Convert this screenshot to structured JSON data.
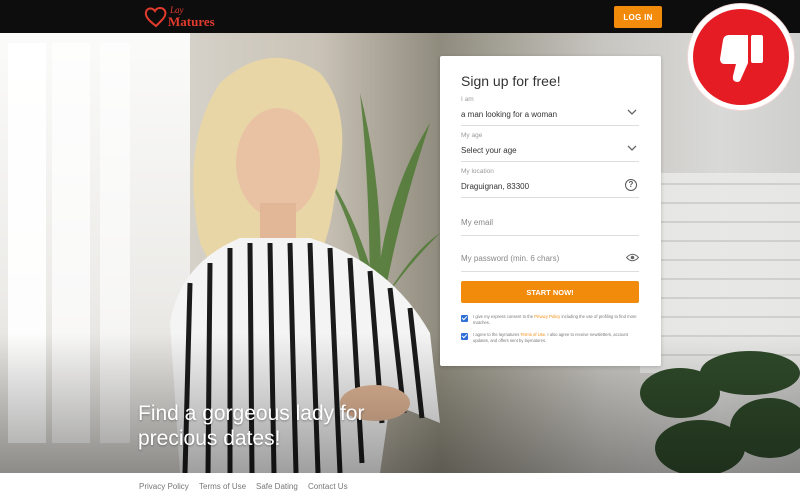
{
  "header": {
    "logo_line1": "Lay",
    "logo_line2": "Matures",
    "login_label": "LOG IN"
  },
  "hero": {
    "tagline": "Find a gorgeous lady for precious dates!"
  },
  "signup": {
    "title": "Sign up for free!",
    "fields": [
      {
        "label": "I am",
        "value": "a man looking for a woman"
      },
      {
        "label": "My age",
        "value": "Select your age"
      },
      {
        "label": "My location",
        "value": "Draguignan, 83300"
      },
      {
        "placeholder": "My email"
      },
      {
        "placeholder": "My password (min. 6 chars)"
      }
    ],
    "submit_label": "START NOW!",
    "consent1": {
      "before": "I give my express consent to the ",
      "link": "Privacy Policy",
      "after": " including the use of profiling to find more matches."
    },
    "consent2": {
      "before": "I agree to the laymatures ",
      "link": "Terms of Use",
      "after": ". I also agree to receive newsletters, account updates, and offers sent by laymatures."
    }
  },
  "badge": {
    "icon": "thumbs-down-icon",
    "color": "#e51c23"
  },
  "footer": {
    "links": [
      "Privacy Policy",
      "Terms of Use",
      "Safe Dating",
      "Contact Us"
    ]
  },
  "colors": {
    "accent": "#f28b0c",
    "topbar": "#0d0d0d",
    "logo": "#e23b2e"
  }
}
